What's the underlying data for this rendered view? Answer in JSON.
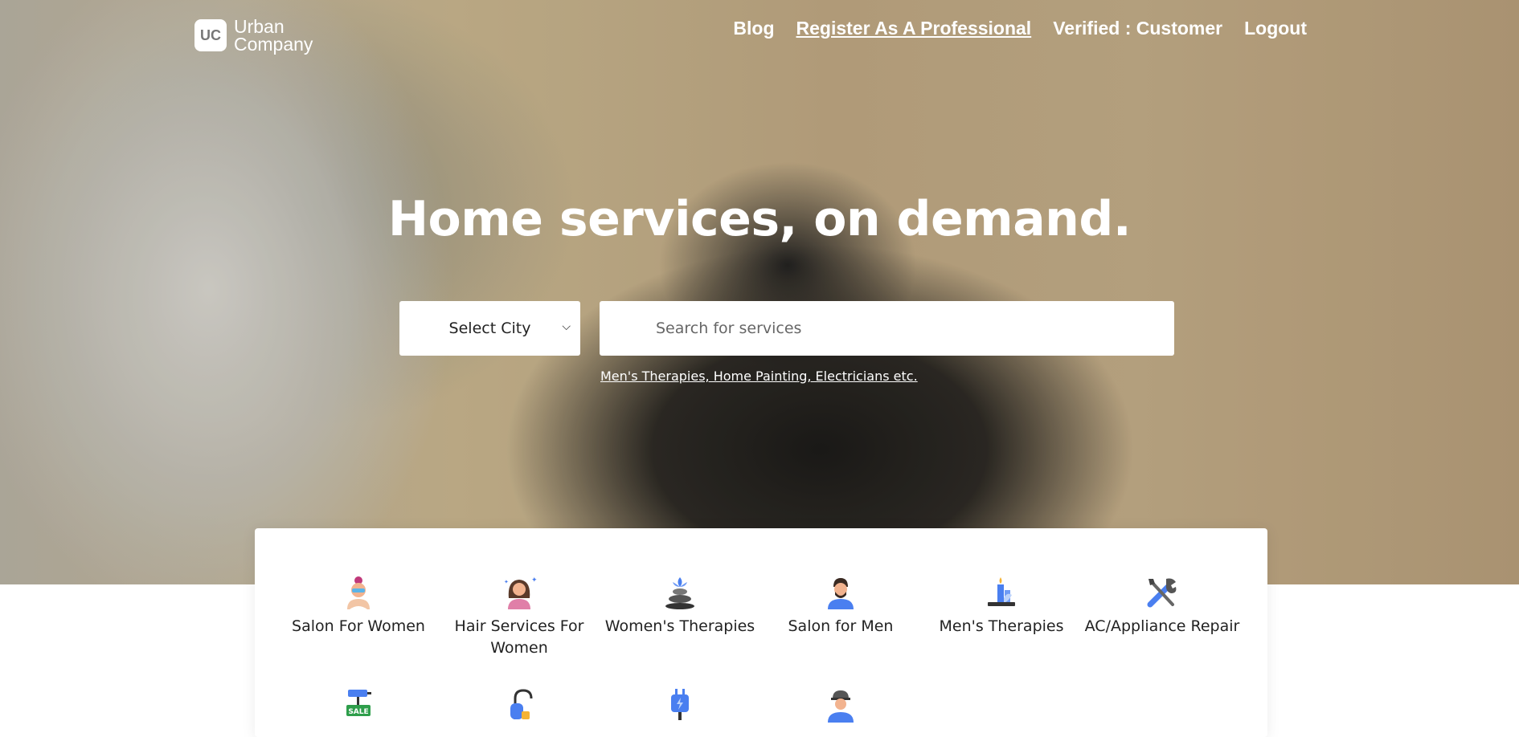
{
  "brand": {
    "logo_mark": "UC",
    "name_line1": "Urban",
    "name_line2": "Company"
  },
  "nav": {
    "blog": "Blog",
    "register": "Register As A Professional",
    "verified": "Verified : Customer",
    "logout": "Logout"
  },
  "hero": {
    "headline": "Home services, on demand.",
    "city_select": "Select City",
    "search_placeholder": "Search for services",
    "suggestion": "Men's Therapies, Home Painting, Electricians etc."
  },
  "categories": [
    {
      "label": "Salon For Women",
      "icon": "salon-women-icon"
    },
    {
      "label": "Hair Services For Women",
      "icon": "hair-services-icon"
    },
    {
      "label": "Women's Therapies",
      "icon": "stones-icon"
    },
    {
      "label": "Salon for Men",
      "icon": "salon-men-icon"
    },
    {
      "label": "Men's Therapies",
      "icon": "candle-icon"
    },
    {
      "label": "AC/Appliance Repair",
      "icon": "tools-icon"
    },
    {
      "label": "",
      "icon": "paint-roller-sale-icon"
    },
    {
      "label": "",
      "icon": "vacuum-icon"
    },
    {
      "label": "",
      "icon": "plug-icon"
    },
    {
      "label": "",
      "icon": "worker-icon"
    }
  ],
  "colors": {
    "card_bg": "#ffffff",
    "text_dark": "#222222",
    "icon_blue": "#4a7ff0"
  }
}
